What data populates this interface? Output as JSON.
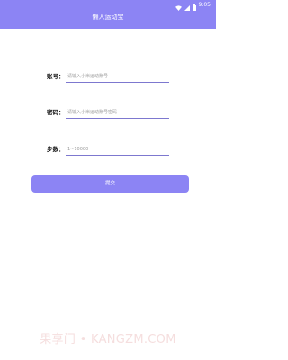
{
  "status_bar": {
    "time": "9:05",
    "icons": [
      "wifi-icon",
      "signal-icon",
      "battery-icon"
    ]
  },
  "app": {
    "title": "懒人运动宝"
  },
  "form": {
    "account": {
      "label": "账号：",
      "placeholder": "请输入小米运动账号",
      "value": ""
    },
    "password": {
      "label": "密码：",
      "placeholder": "请输入小米运动账号密码",
      "value": ""
    },
    "steps": {
      "label": "步数：",
      "placeholder": "1~10000",
      "value": ""
    }
  },
  "submit": {
    "label": "提交"
  },
  "watermark": {
    "text": "果享门 • KANGZM.COM"
  },
  "colors": {
    "accent": "#8c84f4",
    "input_underline": "#7d78cf",
    "watermark": "#f5dede"
  }
}
